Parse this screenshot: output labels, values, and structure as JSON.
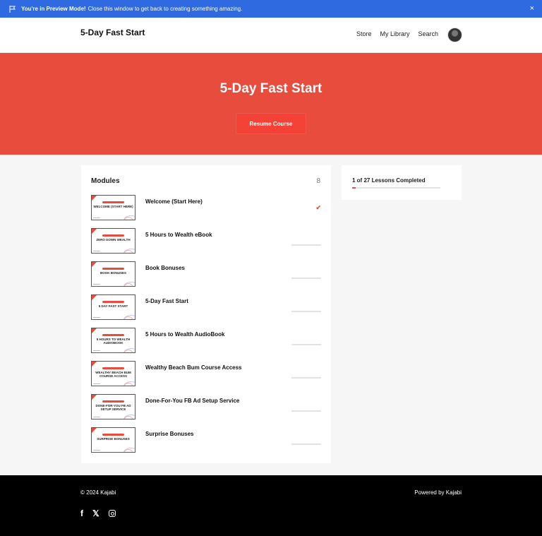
{
  "preview": {
    "bold_text": "You're in Preview Mode!",
    "text": "Close this window to get back to creating something amazing.",
    "close_label": "×"
  },
  "header": {
    "site_title": "5-Day Fast Start",
    "nav": [
      "Store",
      "My Library",
      "Search"
    ]
  },
  "hero": {
    "title": "5-Day Fast Start",
    "button_label": "Resume Course"
  },
  "modules": {
    "title": "Modules",
    "count": "8",
    "items": [
      {
        "name": "Welcome (Start Here)",
        "thumb": "WELCOME (START HERE)",
        "completed": true
      },
      {
        "name": "5 Hours to Wealth eBook",
        "thumb": "ZERO DOWN WEALTH",
        "completed": false
      },
      {
        "name": "Book Bonuses",
        "thumb": "BOOK BONUSES",
        "completed": false
      },
      {
        "name": "5-Day Fast Start",
        "thumb": "5 DAY FAST START",
        "completed": false
      },
      {
        "name": "5 Hours to Wealth AudioBook",
        "thumb": "5 HOURS TO WEALTH AUDIOBOOK",
        "completed": false
      },
      {
        "name": "Wealthy Beach Bum Course Access",
        "thumb": "WEALTHY BEACH BUM COURSE ACCESS",
        "completed": false
      },
      {
        "name": "Done-For-You FB Ad Setup Service",
        "thumb": "DONE-FOR-YOU FB AD SETUP SERVICE",
        "completed": false
      },
      {
        "name": "Surprise Bonuses",
        "thumb": "SURPRISE BONUSES",
        "completed": false
      }
    ]
  },
  "progress": {
    "text": "1 of 27 Lessons Completed",
    "fraction": 0.037
  },
  "footer": {
    "copyright": "© 2024 Kajabi",
    "powered": "Powered by Kajabi",
    "facebook_glyph": "f",
    "x_glyph": "𝕏"
  },
  "colors": {
    "preview_blue": "#2f6ae0",
    "accent_red": "#e84c3d",
    "footer_black": "#000000"
  },
  "icons": [
    "flag-icon",
    "close-icon",
    "avatar",
    "check-icon",
    "facebook-icon",
    "x-icon",
    "instagram-icon"
  ]
}
